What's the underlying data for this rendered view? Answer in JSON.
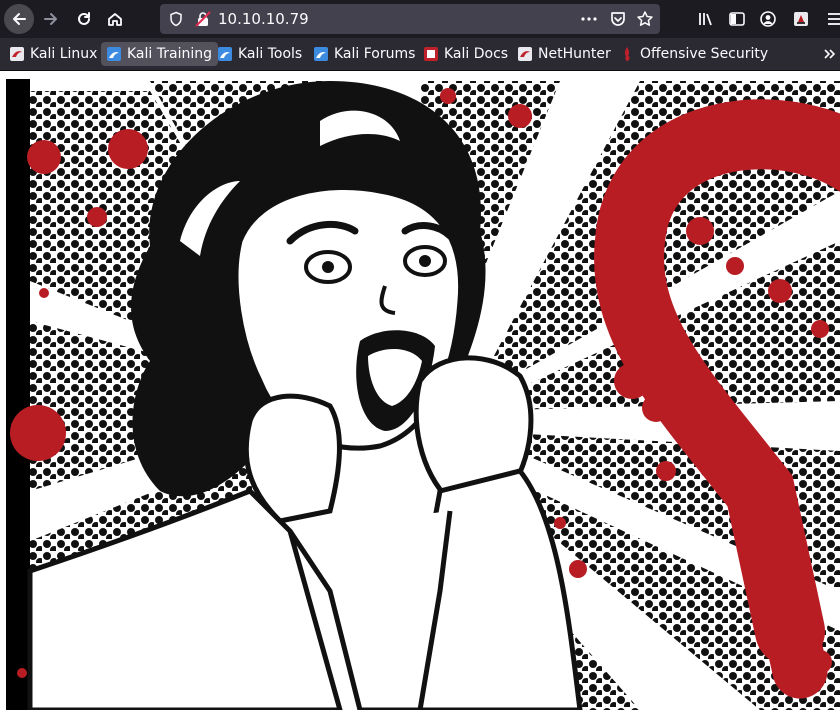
{
  "browser": {
    "url": "10.10.10.79",
    "icons": [
      "back-icon",
      "forward-icon",
      "reload-icon",
      "home-icon",
      "shield-icon",
      "insecure-lock-icon",
      "more-icon",
      "pocket-icon",
      "star-icon",
      "library-icon",
      "sidebar-icon",
      "account-icon",
      "extension-icon",
      "menu-icon"
    ]
  },
  "bookmarks": [
    {
      "label": "Kali Linux"
    },
    {
      "label": "Kali Training"
    },
    {
      "label": "Kali Tools"
    },
    {
      "label": "Kali Forums"
    },
    {
      "label": "Kali Docs"
    },
    {
      "label": "NetHunter"
    },
    {
      "label": "Offensive Security"
    }
  ],
  "colors": {
    "toolbar_bg": "#1c1b22",
    "bookmarks_bg": "#2b2a33",
    "urlbar_bg": "#42414d",
    "blood_red": "#b81d24",
    "ink": "#111111"
  },
  "page": {
    "image_subject": "pop-art screaming woman with red heartbleed heart"
  }
}
